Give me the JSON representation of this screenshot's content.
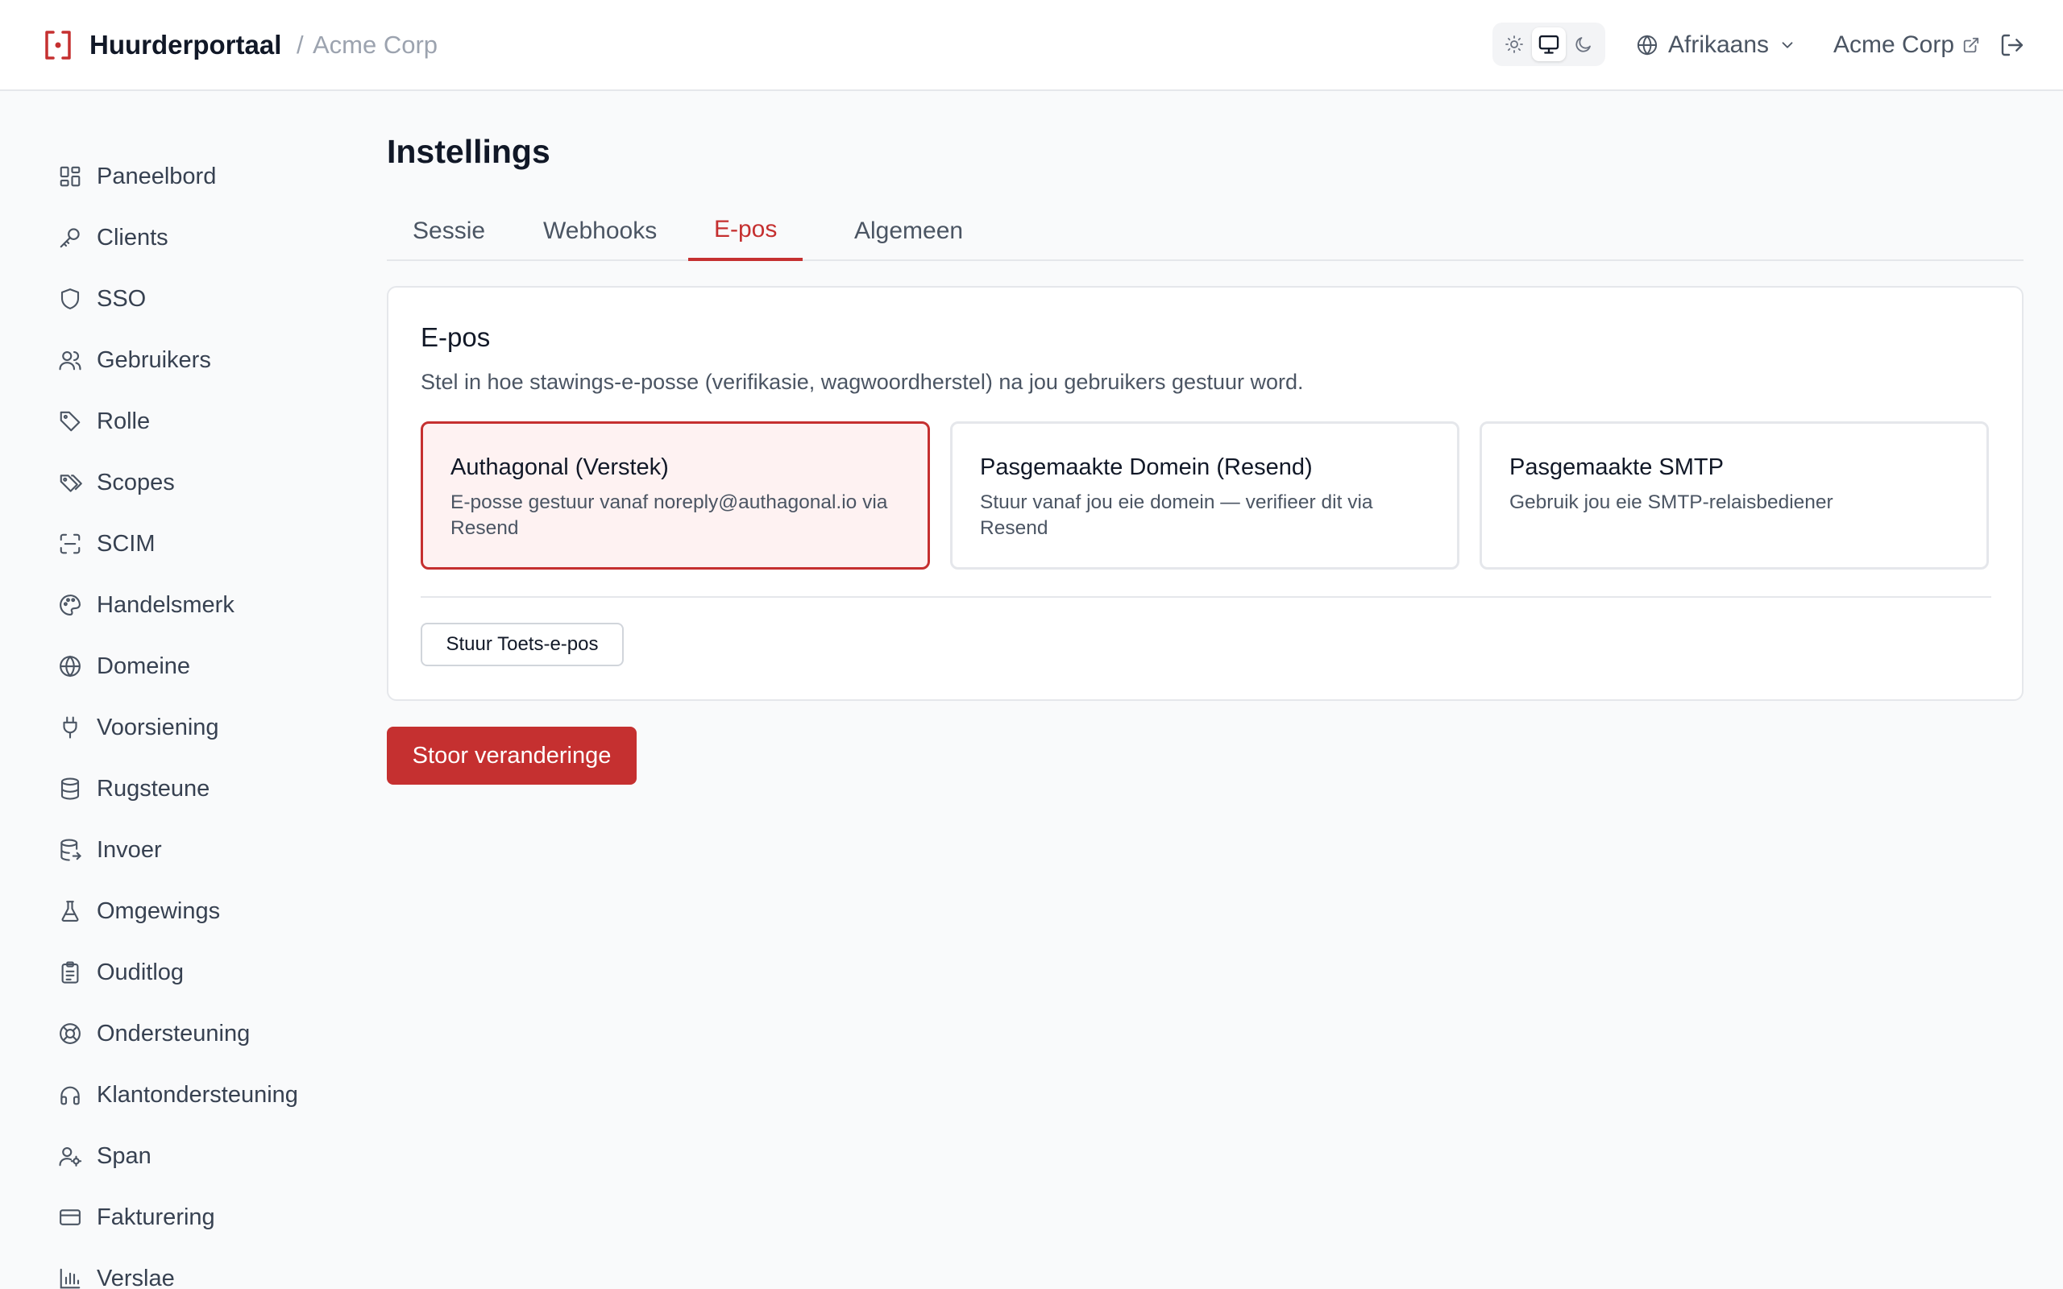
{
  "header": {
    "app_title": "Huurderportaal",
    "crumb_separator": "/",
    "tenant": "Acme Corp",
    "theme_options": [
      "light",
      "system",
      "dark"
    ],
    "theme_selected": "system",
    "language": "Afrikaans",
    "tenant_link": "Acme Corp",
    "brand_color": "#c53030"
  },
  "sidebar": {
    "items": [
      {
        "label": "Paneelbord",
        "icon": "dashboard-icon"
      },
      {
        "label": "Clients",
        "icon": "key-icon"
      },
      {
        "label": "SSO",
        "icon": "shield-icon"
      },
      {
        "label": "Gebruikers",
        "icon": "users-icon"
      },
      {
        "label": "Rolle",
        "icon": "tag-icon"
      },
      {
        "label": "Scopes",
        "icon": "tags-icon"
      },
      {
        "label": "SCIM",
        "icon": "scan-icon"
      },
      {
        "label": "Handelsmerk",
        "icon": "palette-icon"
      },
      {
        "label": "Domeine",
        "icon": "globe-icon"
      },
      {
        "label": "Voorsiening",
        "icon": "plug-icon"
      },
      {
        "label": "Rugsteune",
        "icon": "database-icon"
      },
      {
        "label": "Invoer",
        "icon": "database-import-icon"
      },
      {
        "label": "Omgewings",
        "icon": "flask-icon"
      },
      {
        "label": "Ouditlog",
        "icon": "clipboard-icon"
      },
      {
        "label": "Ondersteuning",
        "icon": "lifebuoy-icon"
      },
      {
        "label": "Klantondersteuning",
        "icon": "headphones-icon"
      },
      {
        "label": "Span",
        "icon": "user-cog-icon"
      },
      {
        "label": "Fakturering",
        "icon": "credit-card-icon"
      },
      {
        "label": "Verslae",
        "icon": "bar-chart-icon"
      }
    ]
  },
  "main": {
    "title": "Instellings",
    "tabs": [
      {
        "label": "Sessie",
        "active": false
      },
      {
        "label": "Webhooks",
        "active": false
      },
      {
        "label": "E-pos",
        "active": true
      },
      {
        "label": "Algemeen",
        "active": false
      }
    ],
    "email": {
      "title": "E-pos",
      "description": "Stel in hoe stawings-e-posse (verifikasie, wagwoordherstel) na jou gebruikers gestuur word.",
      "options": [
        {
          "title": "Authagonal (Verstek)",
          "description": "E-posse gestuur vanaf noreply@authagonal.io via Resend",
          "selected": true
        },
        {
          "title": "Pasgemaakte Domein (Resend)",
          "description": "Stuur vanaf jou eie domein — verifieer dit via Resend",
          "selected": false
        },
        {
          "title": "Pasgemaakte SMTP",
          "description": "Gebruik jou eie SMTP-relaisbediener",
          "selected": false
        }
      ],
      "test_button": "Stuur Toets-e-pos"
    },
    "save_button": "Stoor veranderinge"
  }
}
